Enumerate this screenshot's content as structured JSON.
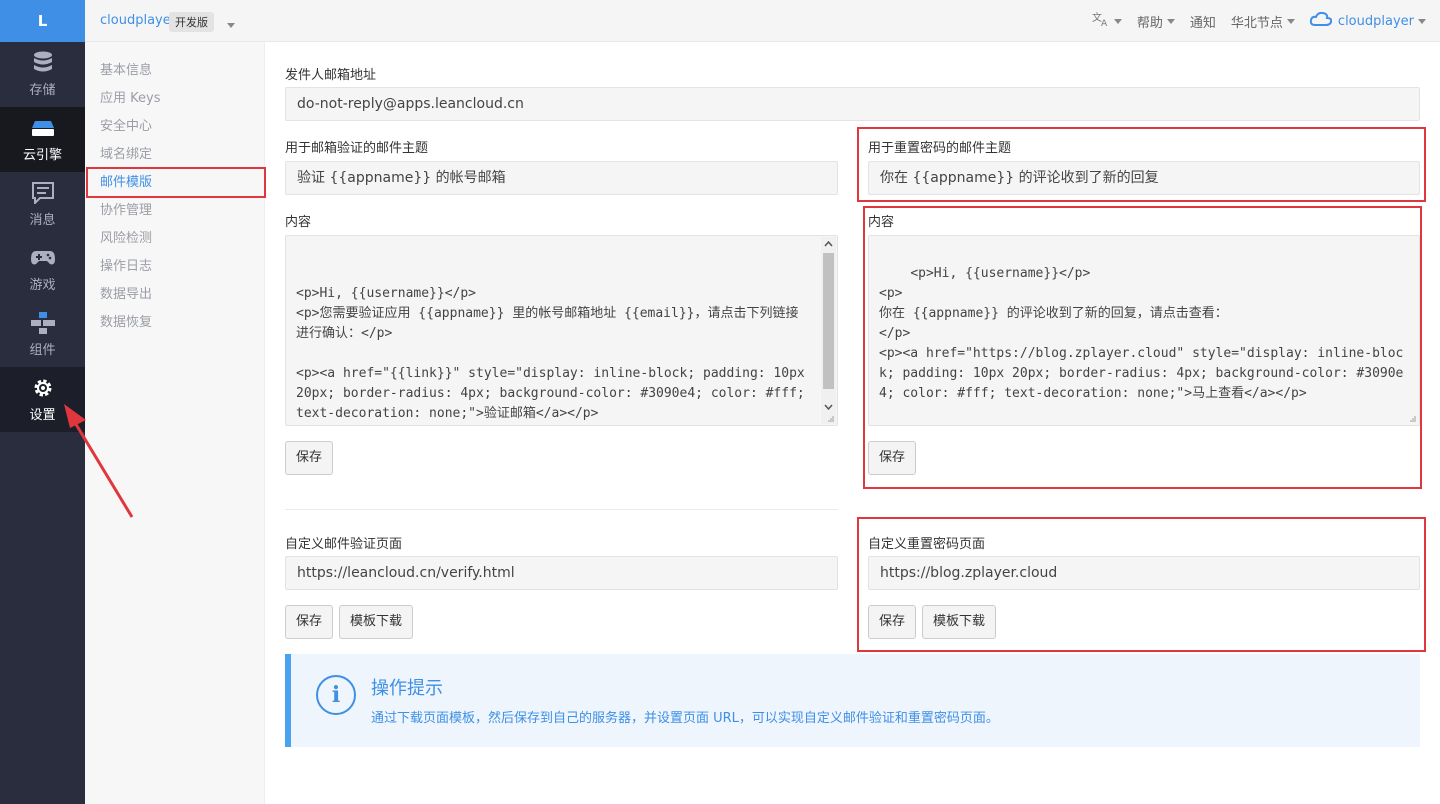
{
  "leftbar": {
    "logo": "L",
    "items": [
      {
        "label": "存储",
        "icon": "database-icon"
      },
      {
        "label": "云引擎",
        "icon": "server-icon"
      },
      {
        "label": "消息",
        "icon": "message-icon"
      },
      {
        "label": "游戏",
        "icon": "gamepad-icon"
      },
      {
        "label": "组件",
        "icon": "components-icon"
      },
      {
        "label": "设置",
        "icon": "gear-icon"
      }
    ]
  },
  "topbar": {
    "app_name": "cloudplayer",
    "app_badge": "开发版",
    "translate_icon": "translate-icon",
    "help": "帮助",
    "notify": "通知",
    "region": "华北节点",
    "user": "cloudplayer"
  },
  "submenu": {
    "items": [
      "基本信息",
      "应用 Keys",
      "安全中心",
      "域名绑定",
      "邮件模版",
      "协作管理",
      "风险检测",
      "操作日志",
      "数据导出",
      "数据恢复"
    ],
    "active_index": 4
  },
  "form": {
    "sender_label": "发件人邮箱地址",
    "sender_value": "do-not-reply@apps.leancloud.cn",
    "verify_subject_label": "用于邮箱验证的邮件主题",
    "verify_subject_value": "验证 {{appname}} 的帐号邮箱",
    "verify_content_label": "内容",
    "verify_content_value": "\n<p>Hi, {{username}}</p>\n<p>您需要验证应用 {{appname}} 里的帐号邮箱地址 {{email}}，请点击下列链接进行确认：</p>\n\n<p><a href=\"{{link}}\" style=\"display: inline-block; padding: 10px 20px; border-radius: 4px; background-color: #3090e4; color: #fff; text-decoration: none;\">验证邮箱</a></p>",
    "reset_subject_label": "用于重置密码的邮件主题",
    "reset_subject_value": "你在 {{appname}} 的评论收到了新的回复",
    "reset_content_label": "内容",
    "reset_content_value": "<p>Hi, {{username}}</p>\n<p>\n你在 {{appname}} 的评论收到了新的回复，请点击查看：\n</p>\n<p><a href=\"https://blog.zplayer.cloud\" style=\"display: inline-block; padding: 10px 20px; border-radius: 4px; background-color: #3090e4; color: #fff; text-decoration: none;\">马上查看</a></p>",
    "save": "保存",
    "custom_verify_label": "自定义邮件验证页面",
    "custom_verify_value": "https://leancloud.cn/verify.html",
    "custom_reset_label": "自定义重置密码页面",
    "custom_reset_value": "https://blog.zplayer.cloud",
    "download": "模板下载"
  },
  "tip": {
    "title": "操作提示",
    "text": "通过下载页面模板，然后保存到自己的服务器，并设置页面 URL，可以实现自定义邮件验证和重置密码页面。"
  },
  "colors": {
    "accent": "#3f8fe6",
    "annotation": "#e0363d",
    "sidebar_bg": "#2a2d3e"
  }
}
